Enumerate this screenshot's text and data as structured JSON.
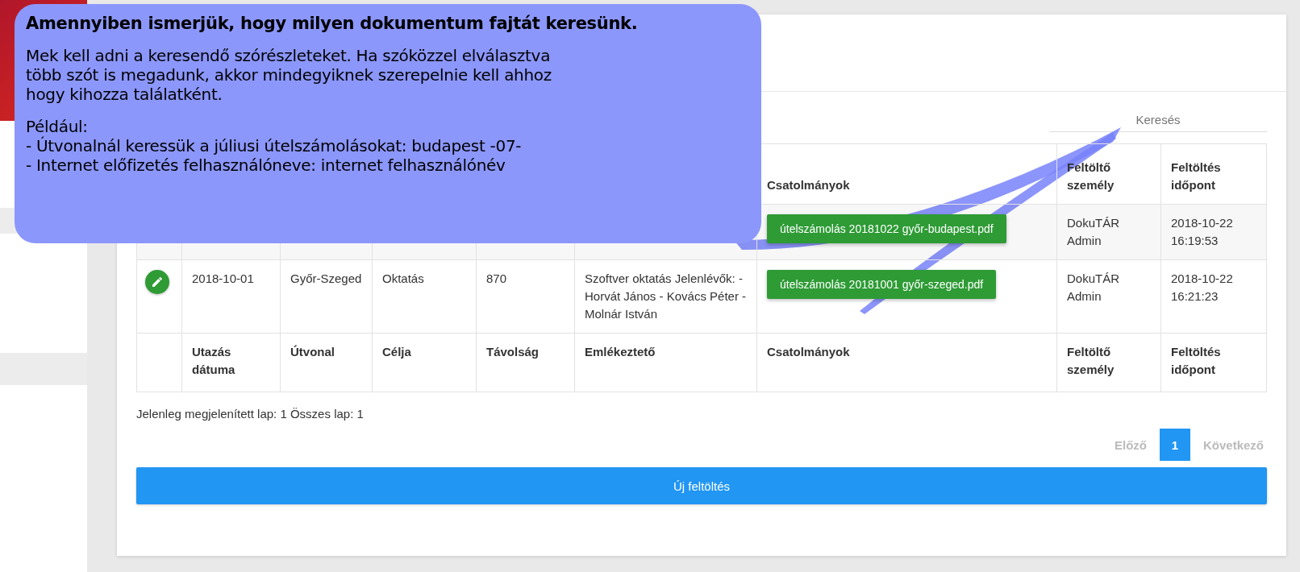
{
  "card": {
    "search": {
      "placeholder": "Keresés"
    }
  },
  "table": {
    "columns": [
      "Csatolmányok",
      "Feltöltő személy",
      "Feltöltés időpont"
    ],
    "rows": [
      {
        "attachment": "útelszámolás 20181022 győr-budapest.pdf",
        "uploader": "DokuTÁR Admin",
        "uploaded": "2018-10-22 16:19:53"
      },
      {
        "date": "2018-10-01",
        "route": "Győr-Szeged",
        "purpose": "Oktatás",
        "distance": "870",
        "memo": "Szoftver oktatás Jelenlévők: - Horvát János - Kovács Péter - Molnár István",
        "attachment": "útelszámolás 20181001 győr-szeged.pdf",
        "uploader": "DokuTÁR Admin",
        "uploaded": "2018-10-22 16:21:23"
      }
    ],
    "footer_columns": [
      "Utazás dátuma",
      "Útvonal",
      "Célja",
      "Távolság",
      "Emlékeztető",
      "Csatolmányok",
      "Feltöltő személy",
      "Feltöltés időpont"
    ]
  },
  "page_info": "Jelenleg megjelenített lap: 1 Összes lap: 1",
  "pagination": {
    "previous": {
      "label": "Előző",
      "disabled": true
    },
    "pages": [
      {
        "label": "1",
        "selected": true
      }
    ],
    "next": {
      "label": "Következő",
      "disabled": true
    }
  },
  "upload_button": "Új feltöltés",
  "tooltip": {
    "title": "Amennyiben ismerjük, hogy milyen dokumentum fajtát keresünk.",
    "text": [
      "Mek kell adni a keresendő szórészleteket. Ha szóközzel elválasztva",
      "több szót is megadunk, akkor mindegyiknek szerepelnie kell ahhoz",
      "hogy kihozza találatként."
    ],
    "example": [
      "Például:",
      "- Útvonalnál keressük a júliusi útelszámolásokat: budapest -07-",
      "- Internet előfizetés felhasználóneve: internet felhasználónév"
    ]
  }
}
